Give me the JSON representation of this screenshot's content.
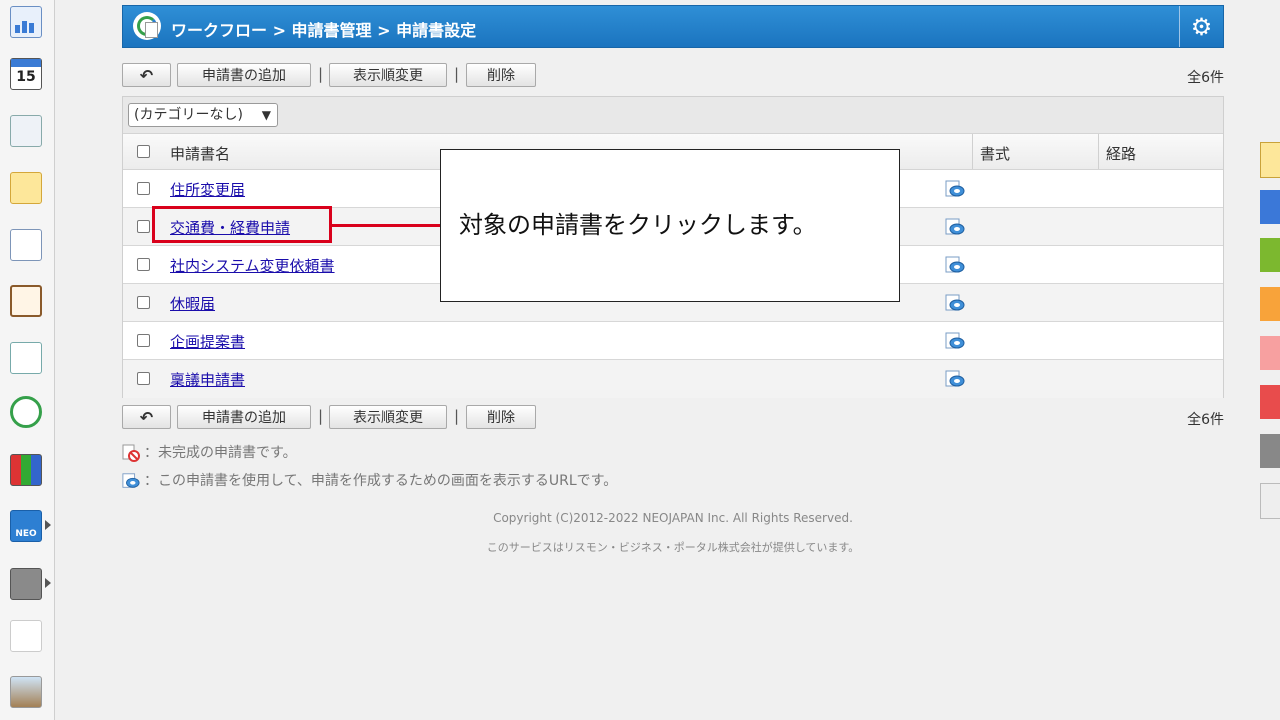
{
  "header": {
    "breadcrumb": "ワークフロー > 申請書管理 > 申請書設定"
  },
  "toolbar": {
    "back_label": "",
    "add_label": "申請書の追加",
    "reorder_label": "表示順変更",
    "delete_label": "削除",
    "separator": "|",
    "count": "全6件"
  },
  "filter": {
    "category_selected": "(カテゴリーなし)"
  },
  "table": {
    "columns": [
      "申請書名",
      "書式",
      "経路"
    ],
    "rows": [
      {
        "name": "住所変更届"
      },
      {
        "name": "交通費・経費申請"
      },
      {
        "name": "社内システム変更依頼書"
      },
      {
        "name": "休暇届"
      },
      {
        "name": "企画提案書"
      },
      {
        "name": "稟議申請書"
      }
    ]
  },
  "legend": {
    "incomplete": "：未完成の申請書です。",
    "url": "：この申請書を使用して、申請を作成するための画面を表示するURLです。"
  },
  "footer": {
    "copyright": "Copyright (C)2012-2022 NEOJAPAN Inc. All Rights Reserved.",
    "provider": "このサービスはリスモン・ビジネス・ポータル株式会社が提供しています。"
  },
  "callout": {
    "text": "対象の申請書をクリックします。"
  },
  "colors": {
    "header": "#1b74bf",
    "link": "#1a0dab",
    "highlight": "#d9001b"
  }
}
